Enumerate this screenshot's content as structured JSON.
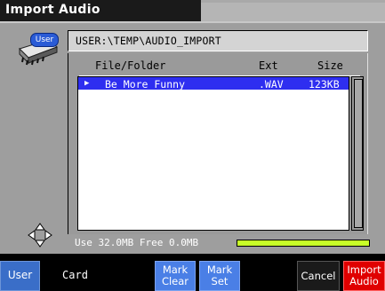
{
  "window": {
    "title": "Import Audio"
  },
  "drive_badge": "User",
  "path": "USER:\\TEMP\\AUDIO_IMPORT",
  "columns": {
    "name": "File/Folder",
    "ext": "Ext",
    "size": "Size"
  },
  "files": [
    {
      "marker": "▶",
      "name": "Be More Funny",
      "ext": ".WAV",
      "size": "123KB",
      "selected": true
    }
  ],
  "status": {
    "text": "Use 32.0MB  Free 0.0MB",
    "used_fraction": 1.0
  },
  "buttons": {
    "user": "User",
    "card": "Card",
    "mark_clear": [
      "Mark",
      "Clear"
    ],
    "mark_set": [
      "Mark",
      "Set"
    ],
    "cancel": "Cancel",
    "import": [
      "Import",
      "Audio"
    ]
  },
  "colors": {
    "selection": "#2e2ef0",
    "meter": "#c8ff28",
    "user_button": "#3a6ec8",
    "mark_button": "#4a7fe6",
    "import_button": "#e00000"
  }
}
